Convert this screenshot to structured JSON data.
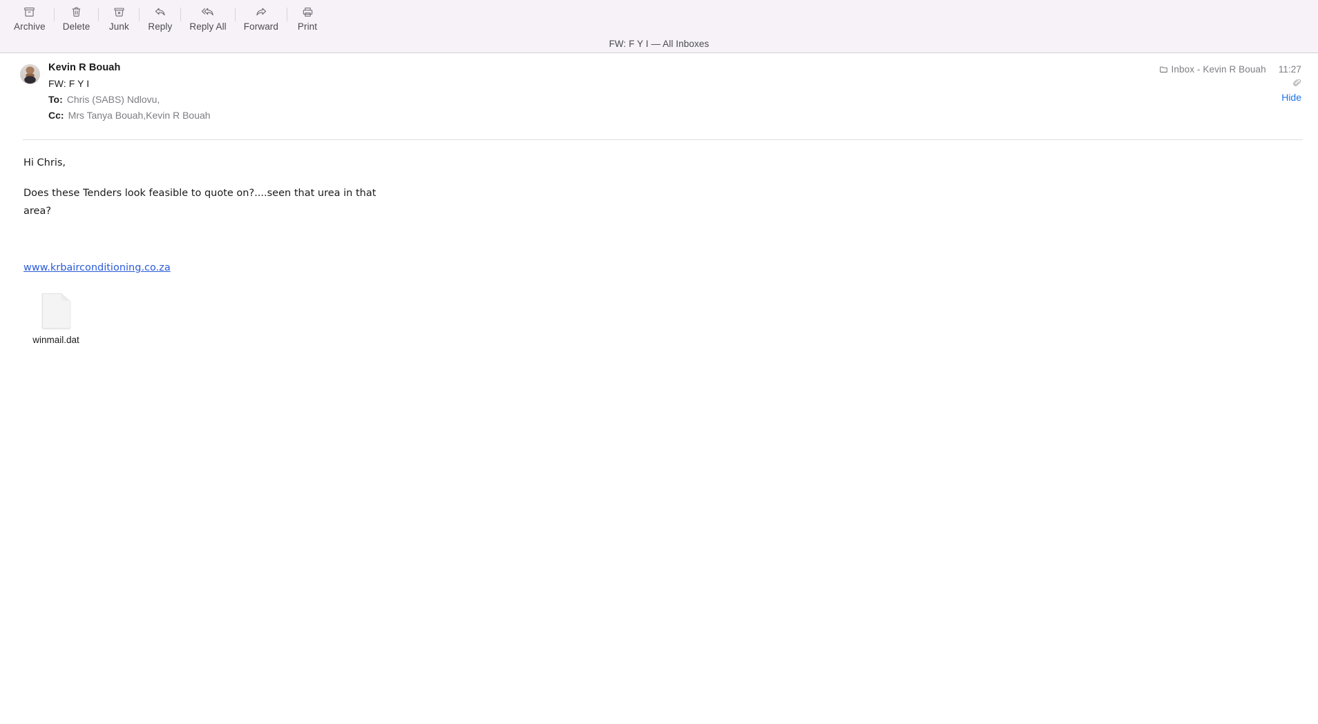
{
  "window": {
    "title": "FW: F Y I — All Inboxes"
  },
  "toolbar": {
    "items": [
      {
        "label": "Archive",
        "icon": "archive-icon"
      },
      {
        "label": "Delete",
        "icon": "trash-icon"
      },
      {
        "label": "Junk",
        "icon": "junk-icon"
      },
      {
        "label": "Reply",
        "icon": "reply-arrow-icon"
      },
      {
        "label": "Reply All",
        "icon": "reply-all-arrow-icon"
      },
      {
        "label": "Forward",
        "icon": "forward-arrow-icon"
      },
      {
        "label": "Print",
        "icon": "printer-icon"
      }
    ]
  },
  "message": {
    "sender": "Kevin R Bouah",
    "subject": "FW: F Y I",
    "to_label": "To:",
    "to_value": "Chris (SABS) Ndlovu,",
    "cc_label": "Cc:",
    "cc_value_1": "Mrs Tanya Bouah,",
    "cc_value_2": "Kevin R Bouah",
    "mailbox": "Inbox - Kevin R Bouah",
    "time": "11:27",
    "hide_label": "Hide",
    "body": {
      "greeting": "Hi Chris,",
      "paragraph_line_1": "Does these Tenders look feasible to quote on?....seen that urea in that",
      "paragraph_line_2": "area?",
      "link": "www.krbairconditioning.co.za"
    },
    "attachments": [
      {
        "name": "winmail.dat",
        "icon": "generic-document-icon"
      }
    ]
  },
  "colors": {
    "toolbar_bg": "#f7f2f8",
    "link": "#2a5bd7",
    "hide_link": "#1a73e8",
    "text": "#1a1a1a",
    "muted": "#7d7d82"
  }
}
